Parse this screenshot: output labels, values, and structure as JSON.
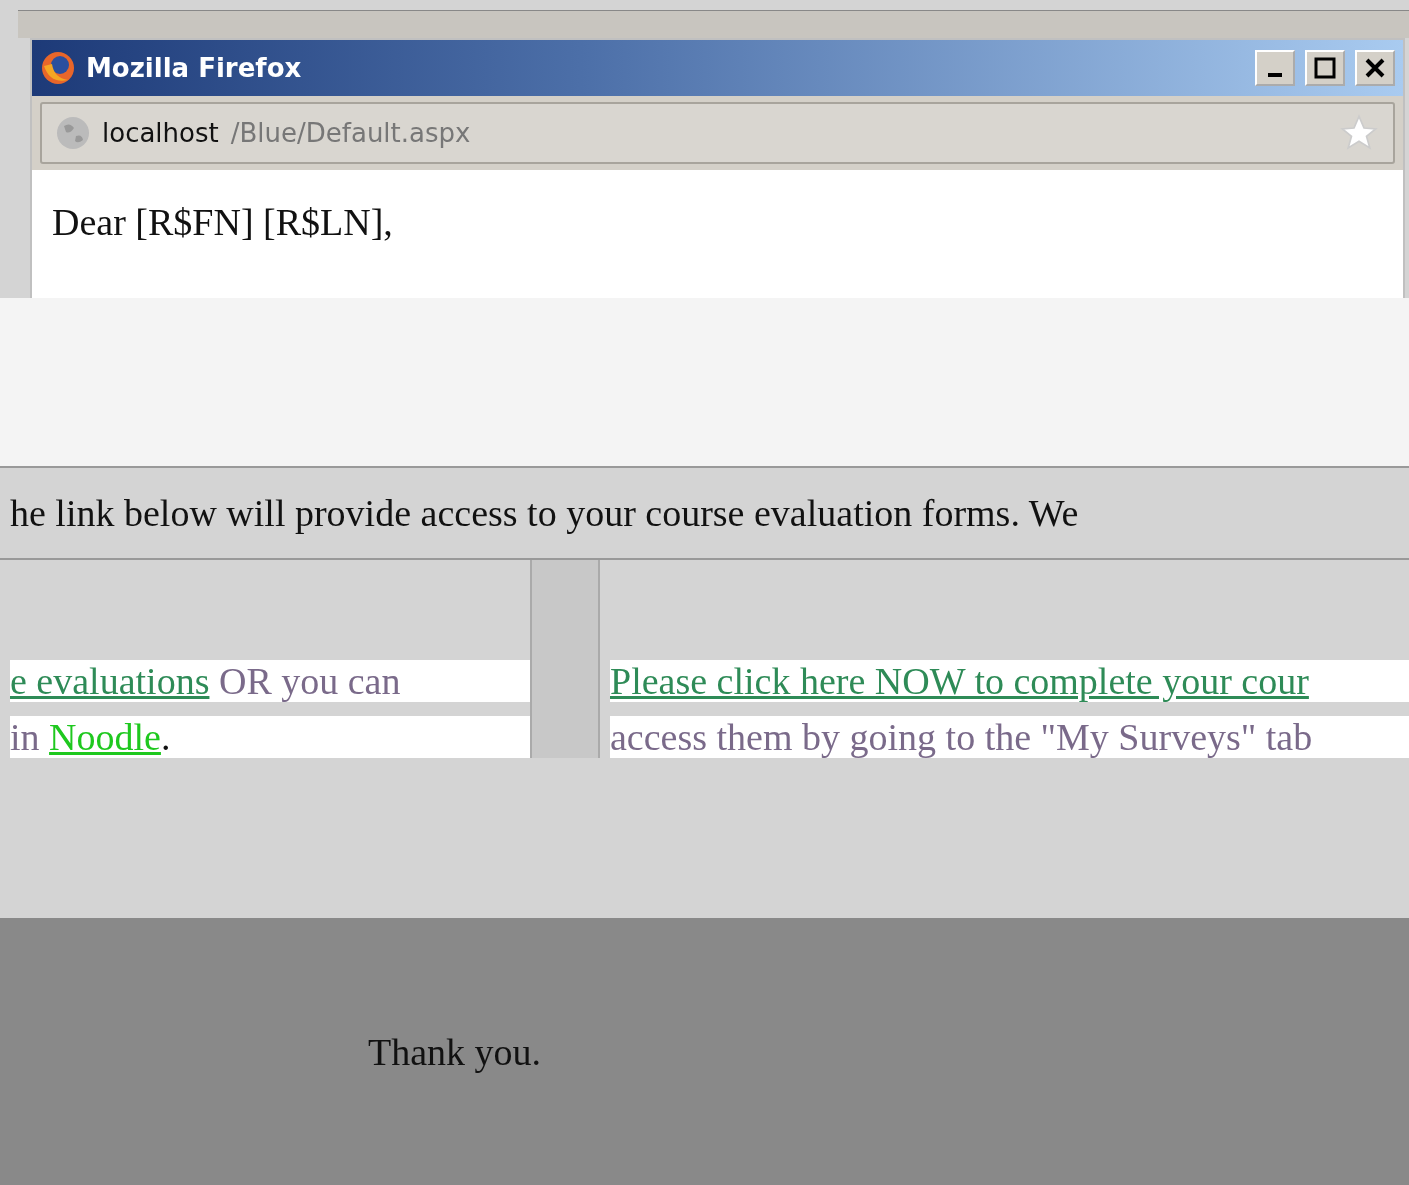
{
  "window": {
    "title": "Mozilla Firefox"
  },
  "address_bar": {
    "host": "localhost",
    "path": "/Blue/Default.aspx"
  },
  "greeting": "Dear [R$FN] [R$LN],",
  "paragraph_fragment": "he link below will provide access to your course evaluation forms. We",
  "left_column": {
    "link": "e evaluations",
    "after_link": " OR you can",
    "line_2_before": "in ",
    "line_2_link": "Noodle",
    "line_2_after": "."
  },
  "right_column": {
    "link": "Please click here NOW to complete your cour",
    "line_2": "access them by going to the \"My Surveys\" tab"
  },
  "closing": "Thank you."
}
